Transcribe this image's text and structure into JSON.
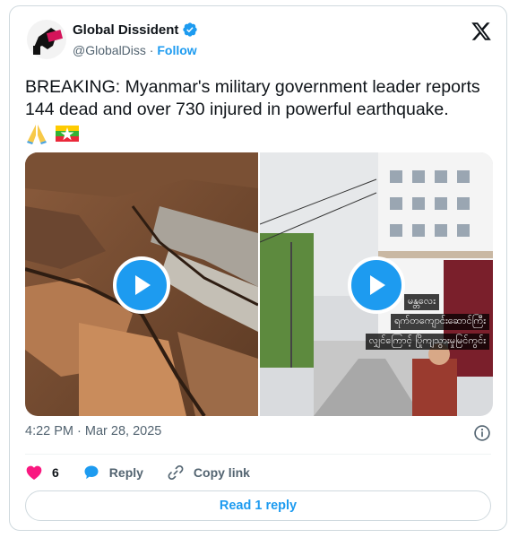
{
  "account": {
    "name": "Global Dissident",
    "handle": "@GlobalDiss",
    "separator": "·",
    "follow_label": "Follow"
  },
  "tweet": {
    "text": "BREAKING: Myanmar's military government leader reports 144 dead and over 730 injured in powerful earthquake.",
    "emojis": [
      "folded-hands-icon",
      "myanmar-flag-icon"
    ],
    "timestamp": "4:22 PM · Mar 28, 2025"
  },
  "media": {
    "left_video": {
      "description_icon": "play-icon"
    },
    "right_video": {
      "caption_lines": [
        "မန္တလေး",
        "ရက်တကျောင်းဆောင်ကြီး",
        "လျှင်ကြောင့် ပြိုကျသွားမှုမြင်ကွင်း"
      ]
    }
  },
  "actions": {
    "like_count": "6",
    "reply_label": "Reply",
    "copy_link_label": "Copy link"
  },
  "read_replies_label": "Read 1 reply",
  "colors": {
    "accent": "#1d9bf0",
    "like": "#f91880",
    "text_primary": "#0f1419",
    "text_secondary": "#536471"
  }
}
